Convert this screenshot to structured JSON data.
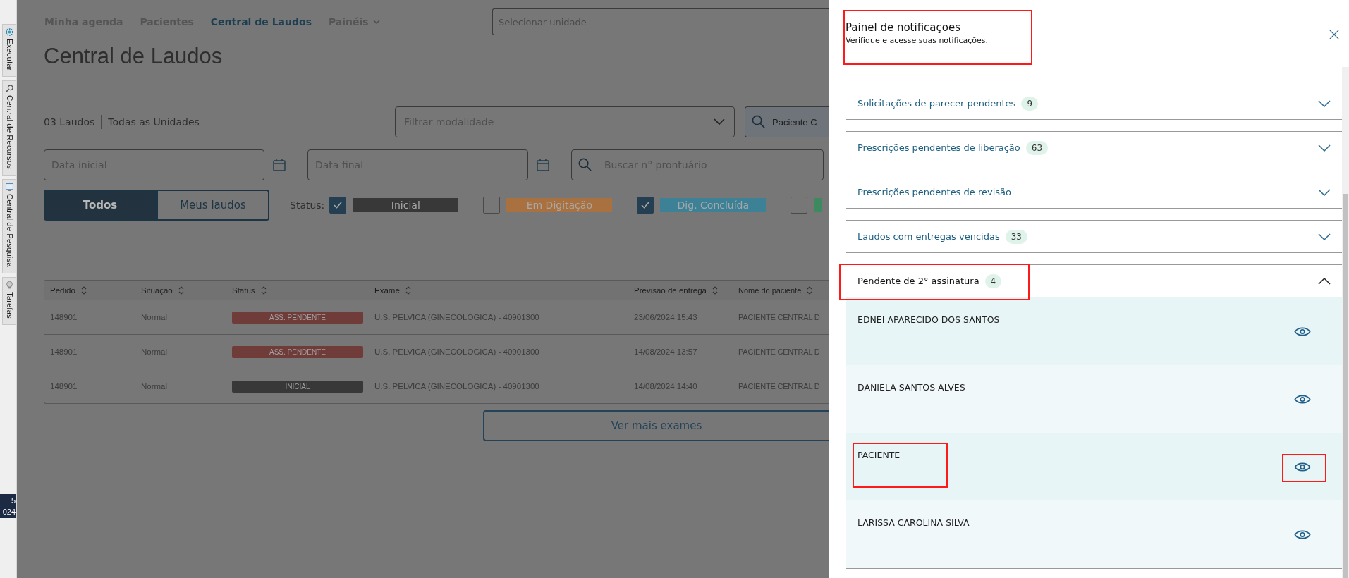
{
  "sidebar": {
    "tabs": [
      {
        "label": "Executar",
        "kind": "gear"
      },
      {
        "label": "Central de Recursos",
        "kind": "search"
      },
      {
        "label": "Central de Pesquisa",
        "kind": "screen"
      },
      {
        "label": "Tarefas",
        "kind": "bulb"
      }
    ]
  },
  "corner_card": {
    "lines": [
      "5",
      "024"
    ]
  },
  "nav": {
    "items": [
      {
        "label": "Minha agenda",
        "selected": false,
        "has_menu": false
      },
      {
        "label": "Pacientes",
        "selected": false,
        "has_menu": false
      },
      {
        "label": "Central de Laudos",
        "selected": true,
        "has_menu": false
      },
      {
        "label": "Painéis",
        "selected": false,
        "has_menu": true
      }
    ]
  },
  "unit_select": {
    "placeholder": "Selecionar unidade"
  },
  "page_title": "Central de Laudos",
  "summary": {
    "count": "03 Laudos",
    "scope": "Todas as Unidades"
  },
  "filters": {
    "modality": {
      "placeholder": "Filtrar modalidade"
    },
    "patient": {
      "value": "Paciente C"
    },
    "date_start": {
      "placeholder": "Data inicial"
    },
    "date_end": {
      "placeholder": "Data final"
    },
    "record": {
      "placeholder": "Buscar n° prontuário"
    }
  },
  "view_toggle": [
    {
      "label": "Todos",
      "selected": true
    },
    {
      "label": "Meus laudos",
      "selected": false
    }
  ],
  "status_filter": {
    "label": "Status:",
    "options": [
      {
        "label": "Inicial",
        "checked": true,
        "color": "#383838"
      },
      {
        "label": "Em Digitação",
        "checked": false,
        "color": "#a8713f"
      },
      {
        "label": "Dig. Concluída",
        "checked": true,
        "color": "#3d8196"
      },
      {
        "checked": false,
        "color": "#3d8a60"
      }
    ]
  },
  "table": {
    "columns": [
      "Pedido",
      "Situação",
      "Status",
      "Exame",
      "Previsão de entrega",
      "Nome do paciente"
    ],
    "rows": [
      {
        "order": "148901",
        "situation": "Normal",
        "status": {
          "label": "ASS. PENDENTE",
          "color": "#6f3c3a"
        },
        "exam": "U.S. PELVICA (GINECOLOGICA) - 40901300",
        "due": "23/06/2024 15:43",
        "patient": "PACIENTE CENTRAL D"
      },
      {
        "order": "148901",
        "situation": "Normal",
        "status": {
          "label": "ASS. PENDENTE",
          "color": "#6f3c3a"
        },
        "exam": "U.S. PELVICA (GINECOLOGICA) - 40901300",
        "due": "14/08/2024 13:57",
        "patient": "PACIENTE CENTRAL D"
      },
      {
        "order": "148901",
        "situation": "Normal",
        "status": {
          "label": "INICIAL",
          "color": "#383838"
        },
        "exam": "U.S. PELVICA (GINECOLOGICA) - 40901300",
        "due": "14/08/2024 14:40",
        "patient": "PACIENTE CENTRAL D"
      }
    ]
  },
  "more_button": "Ver mais exames",
  "panel": {
    "title": "Painel de notificações",
    "subtitle": "Verifique e acesse suas notificações.",
    "highlighted": true,
    "sections": [
      {
        "title": "Solicitações de parecer pendentes",
        "count": "9",
        "expanded": false,
        "highlighted": false
      },
      {
        "title": "Prescrições pendentes de liberação",
        "count": "63",
        "expanded": false,
        "highlighted": false
      },
      {
        "title": "Prescrições pendentes de revisão",
        "expanded": false,
        "highlighted": false
      },
      {
        "title": "Laudos com entregas vencidas",
        "count": "33",
        "expanded": false,
        "highlighted": false
      },
      {
        "title": "Pendente de 2° assinatura",
        "count": "4",
        "expanded": true,
        "highlighted": true,
        "items": [
          {
            "name": "EDNEI APARECIDO DOS SANTOS",
            "highlighted": false,
            "action_highlighted": false
          },
          {
            "name": "DANIELA SANTOS ALVES",
            "highlighted": false,
            "action_highlighted": false
          },
          {
            "name": "PACIENTE",
            "highlighted": true,
            "action_highlighted": true
          },
          {
            "name": "LARISSA CAROLINA SILVA",
            "highlighted": false,
            "action_highlighted": false
          }
        ]
      }
    ]
  }
}
